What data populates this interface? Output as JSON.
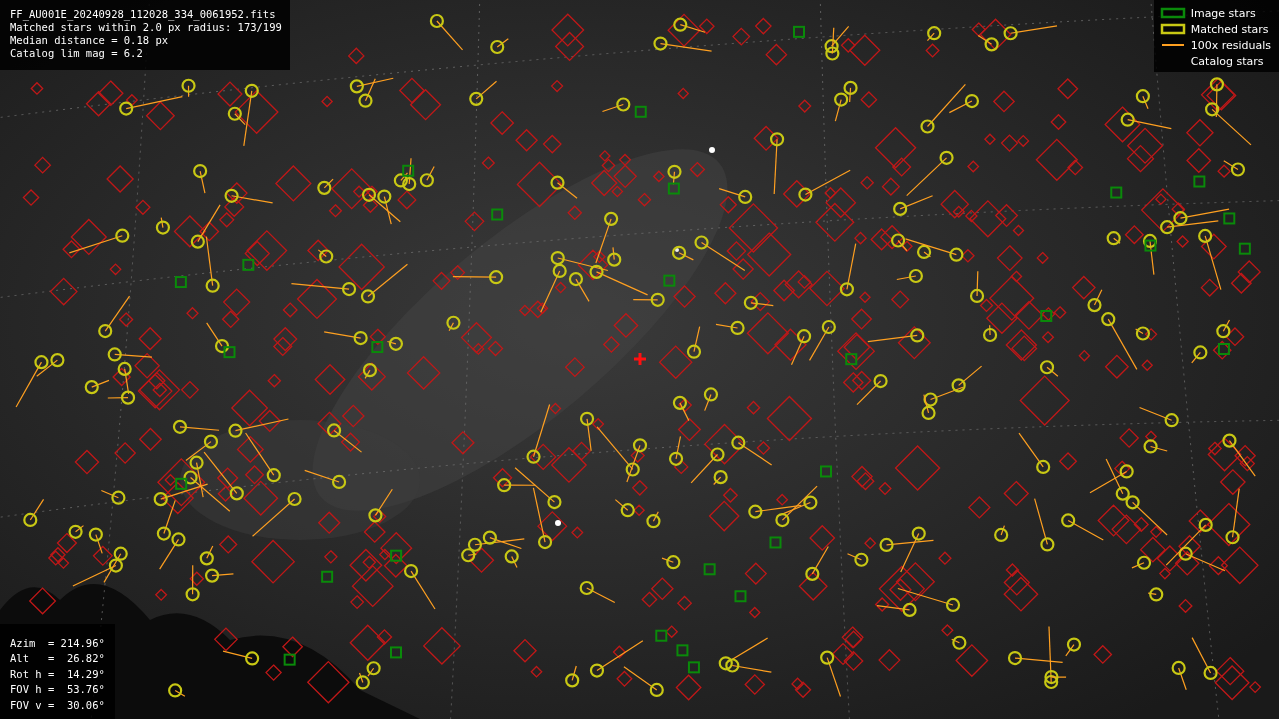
{
  "info_panel": {
    "lines": [
      "FF_AU001E_20240928_112028_334_0061952.fits",
      "Matched stars within 2.0 px radius: 173/199",
      "Median distance = 0.18 px",
      "Catalog lim mag = 6.2"
    ]
  },
  "legend": {
    "items": [
      {
        "label": "Image stars",
        "color": "#0a8a0a"
      },
      {
        "kind": "matched",
        "label": "Matched stars",
        "color": "#c8c814"
      },
      {
        "kind": "residual",
        "label": "100x residuals",
        "color": "#ffa020"
      },
      {
        "kind": "catalog",
        "label": "Catalog stars"
      }
    ]
  },
  "pointing_panel": {
    "lines": [
      "Azim  = 214.96°",
      "Alt   =  26.82°",
      "Rot h =  14.29°",
      "FOV h =  53.76°",
      "FOV v =  30.06°"
    ]
  }
}
